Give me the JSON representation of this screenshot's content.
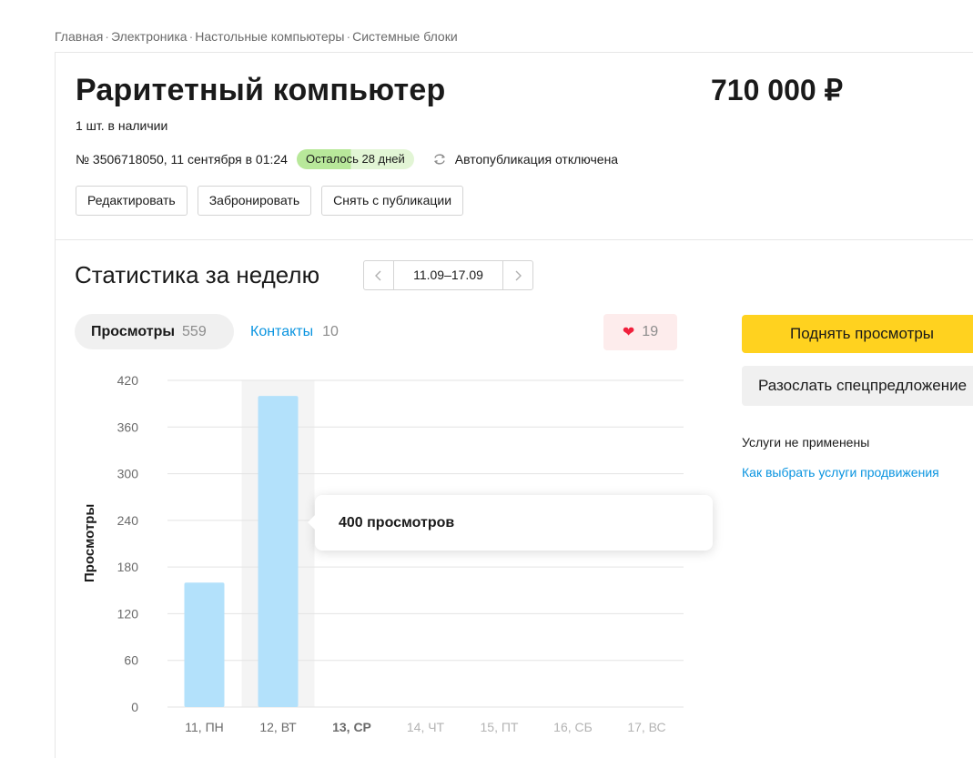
{
  "breadcrumb": {
    "items": [
      "Главная",
      "Электроника",
      "Настольные компьютеры",
      "Системные блоки"
    ],
    "separator": "·"
  },
  "listing": {
    "title": "Раритетный компьютер",
    "price": "710 000 ₽",
    "stock": "1 шт. в наличии",
    "meta": "№ 3506718050, 11 сентября в 01:24",
    "remaining_badge": "Осталось 28 дней",
    "autopublish": "Автопубликация отключена",
    "autopublish_icon": "refresh-icon"
  },
  "actions": {
    "edit": "Редактировать",
    "reserve": "Забронировать",
    "unpublish": "Снять с публикации"
  },
  "stats": {
    "title": "Статистика за неделю",
    "date_range": "11.09–17.09",
    "prev_icon": "chevron-left-icon",
    "next_icon": "chevron-right-icon",
    "tabs": {
      "views_label": "Просмотры",
      "views_count": "559",
      "contacts_label": "Контакты",
      "contacts_count": "10"
    },
    "likes": {
      "icon": "heart-icon",
      "count": "19"
    },
    "tooltip": "400 просмотров"
  },
  "chart_data": {
    "type": "bar",
    "ylabel": "Просмотры",
    "categories": [
      "11, ПН",
      "12, ВТ",
      "13, СР",
      "14, ЧТ",
      "15, ПТ",
      "16, СБ",
      "17, ВС"
    ],
    "values": [
      160,
      400,
      0,
      0,
      0,
      0,
      0
    ],
    "yticks": [
      0,
      60,
      120,
      180,
      240,
      300,
      360,
      420
    ],
    "ylim": [
      0,
      420
    ],
    "highlighted_category": "12, ВТ",
    "current_day": "13, СР",
    "future_days": [
      "14, ЧТ",
      "15, ПТ",
      "16, СБ",
      "17, ВС"
    ],
    "grid": true,
    "colors": {
      "bar": "#b3e1fb",
      "highlight_bg": "#f4f4f4",
      "grid": "#e3e3e3",
      "tick": "#6b6b6b",
      "future_tick": "#b3b3b3",
      "current_tick": "#6b6b6b"
    }
  },
  "sidebar": {
    "promote_button": "Поднять просмотры",
    "special_offer_button": "Разослать спецпредложение",
    "services_none": "Услуги не применены",
    "services_link": "Как выбрать услуги продвижения"
  },
  "colors": {
    "accent_yellow": "#ffd21f",
    "link_blue": "#0a94e0",
    "badge_green": "#b8e89a",
    "heart_red": "#f0203c"
  }
}
